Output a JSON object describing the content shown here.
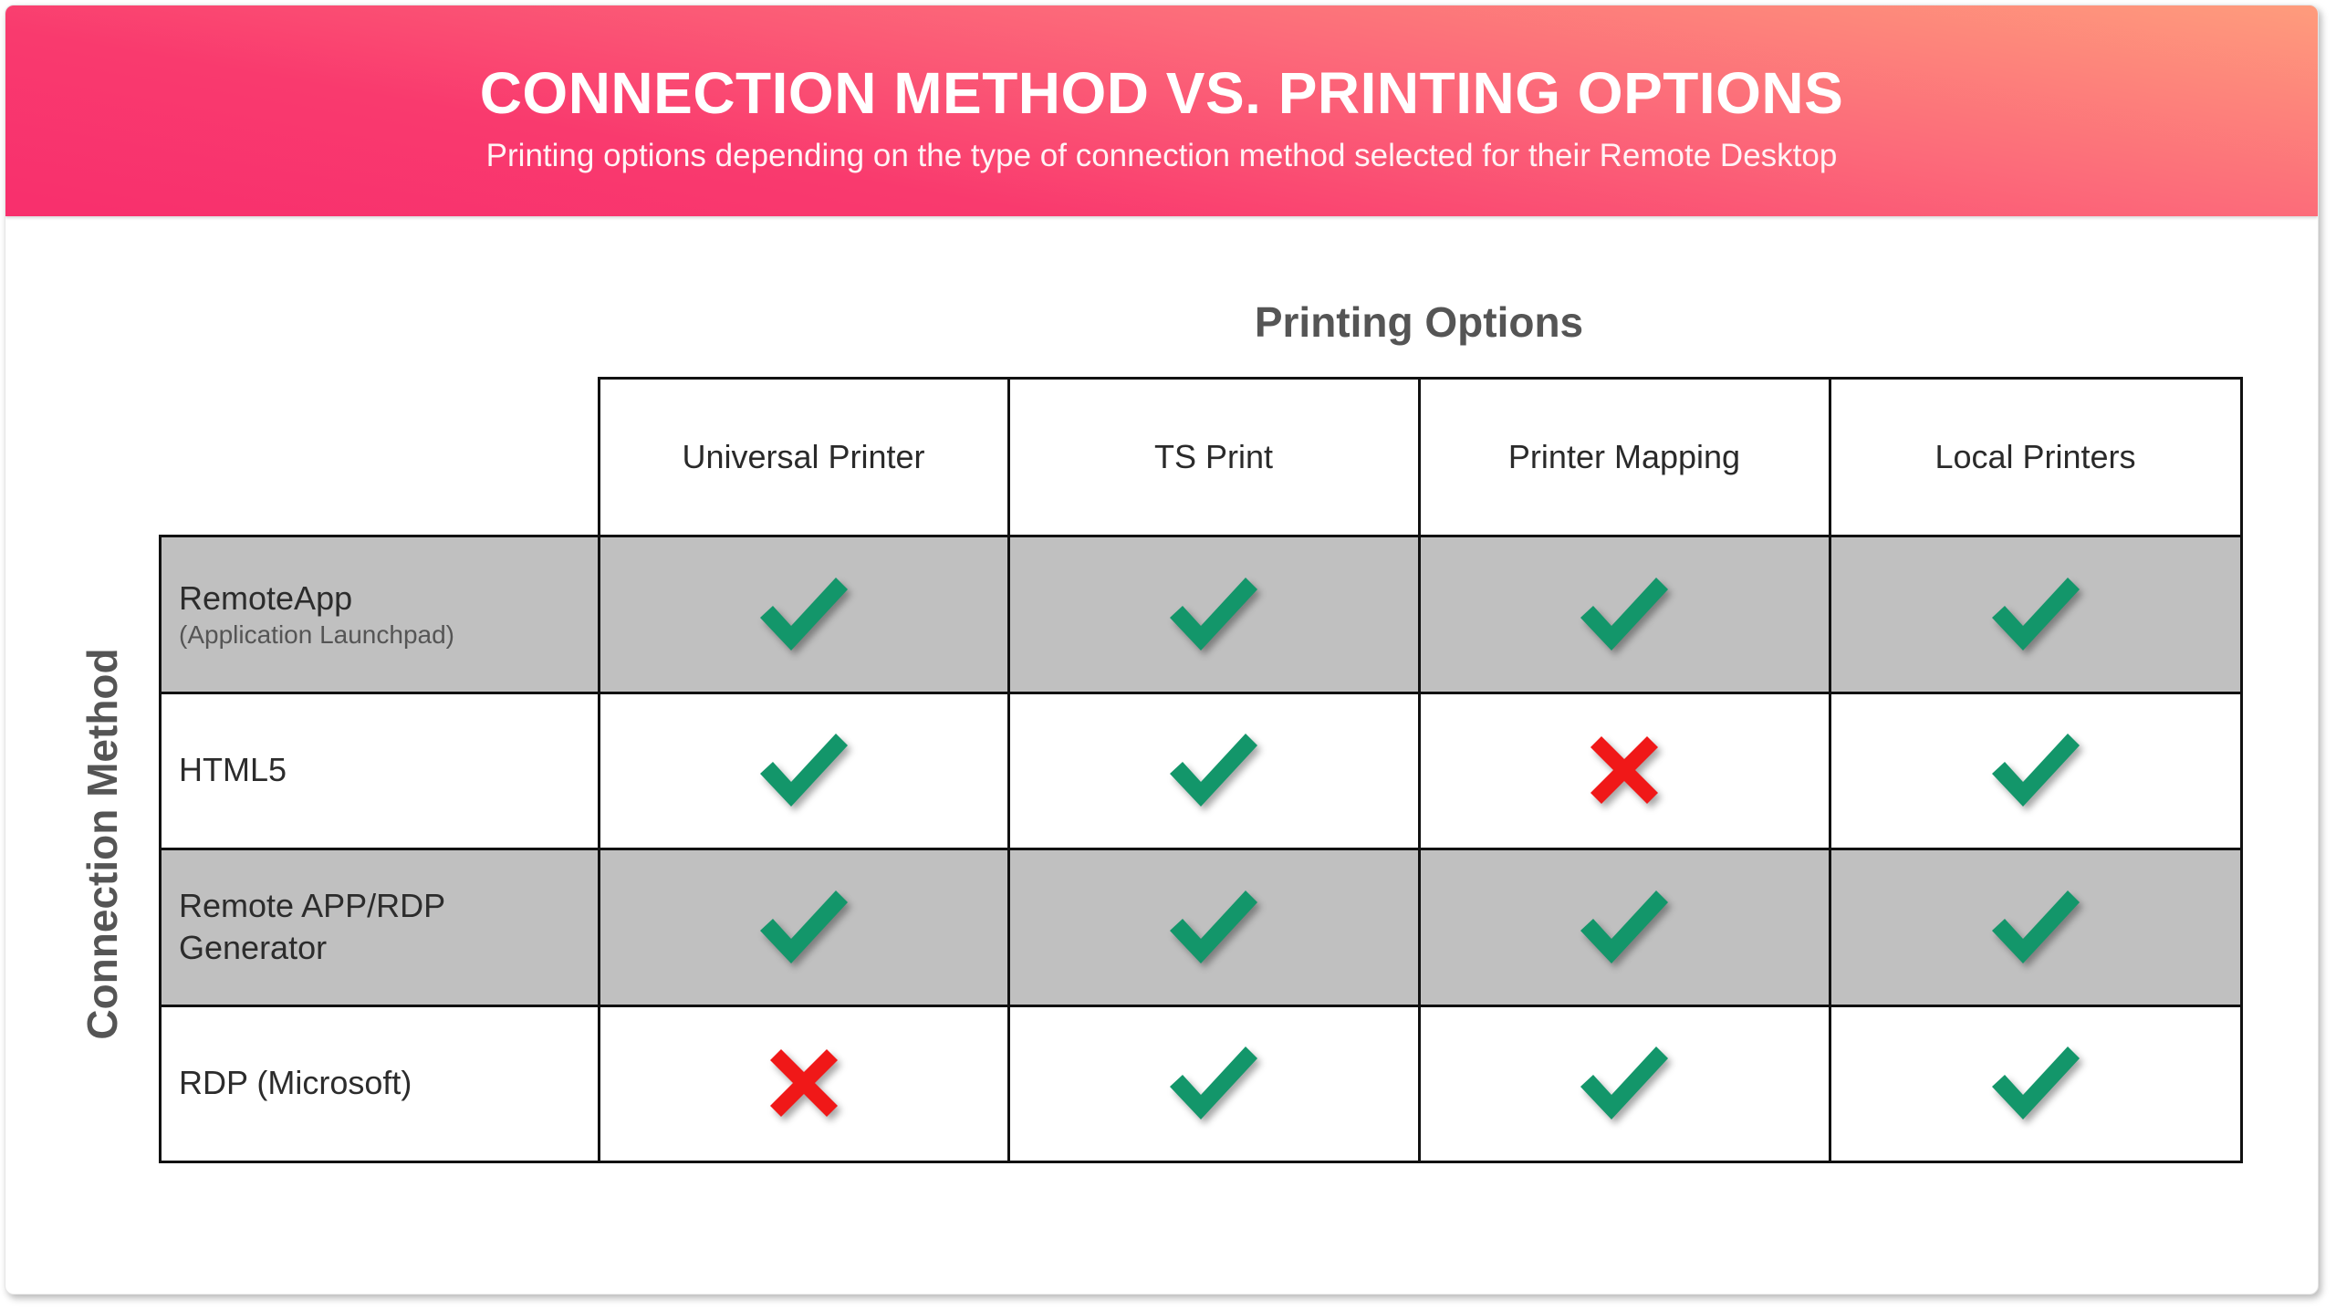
{
  "banner": {
    "title": "CONNECTION METHOD VS. PRINTING OPTIONS",
    "subtitle": "Printing options depending on the type of connection method selected for their Remote Desktop",
    "gradient_colors": [
      "#f82f6d",
      "#fe9c7c"
    ]
  },
  "table": {
    "column_group_title": "Printing Options",
    "row_group_title": "Connection Method",
    "columns": [
      "Universal Printer",
      "TS Print",
      "Printer Mapping",
      "Local Printers"
    ],
    "rows": [
      {
        "label": "RemoteApp",
        "sublabel": "(Application Launchpad)",
        "shaded": true,
        "support": [
          true,
          true,
          true,
          true
        ]
      },
      {
        "label": "HTML5",
        "sublabel": "",
        "shaded": false,
        "support": [
          true,
          true,
          false,
          true
        ]
      },
      {
        "label": "Remote APP/RDP Generator",
        "sublabel": "",
        "shaded": true,
        "support": [
          true,
          true,
          true,
          true
        ]
      },
      {
        "label": "RDP (Microsoft)",
        "sublabel": "",
        "shaded": false,
        "support": [
          false,
          true,
          true,
          true
        ]
      }
    ],
    "icons": {
      "supported": "checkmark-icon",
      "unsupported": "cross-icon"
    },
    "colors": {
      "supported": "#13966a",
      "unsupported": "#f01818",
      "shaded_row": "#c0c0c0"
    }
  }
}
